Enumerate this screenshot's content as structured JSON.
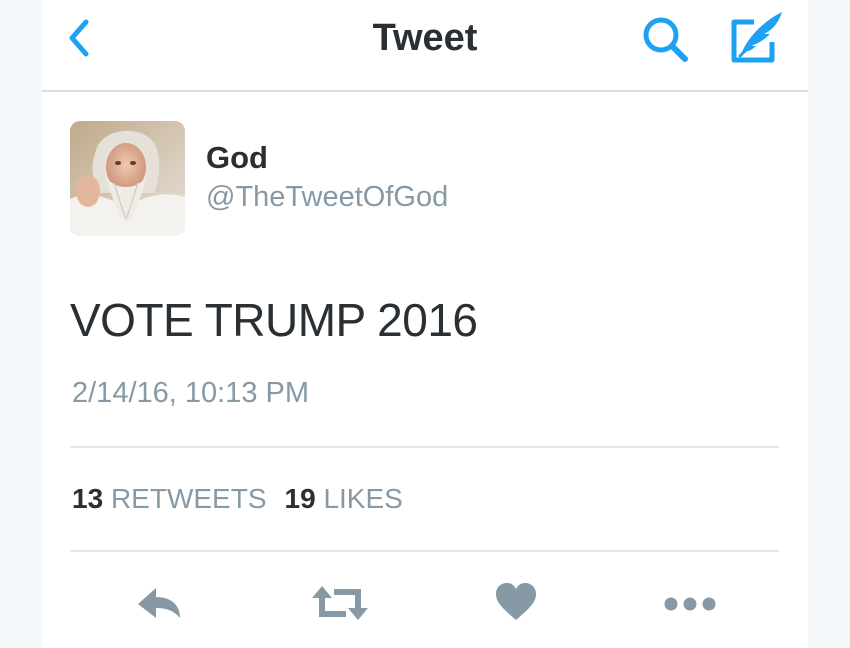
{
  "header": {
    "title": "Tweet",
    "back_icon": "chevron-left-icon",
    "search_icon": "search-icon",
    "compose_icon": "compose-tweet-icon",
    "accent_color": "#1da1f2"
  },
  "tweet": {
    "author_name": "God",
    "author_handle": "@TheTweetOfGod",
    "text": "VOTE TRUMP 2016",
    "timestamp": "2/14/16, 10:13 PM",
    "retweets_count": "13",
    "retweets_label": "RETWEETS",
    "likes_count": "19",
    "likes_label": "LIKES"
  },
  "actions": {
    "reply_icon": "reply-icon",
    "retweet_icon": "retweet-icon",
    "like_icon": "heart-icon",
    "more_icon": "more-dots-icon",
    "icon_color": "#8899a6"
  }
}
